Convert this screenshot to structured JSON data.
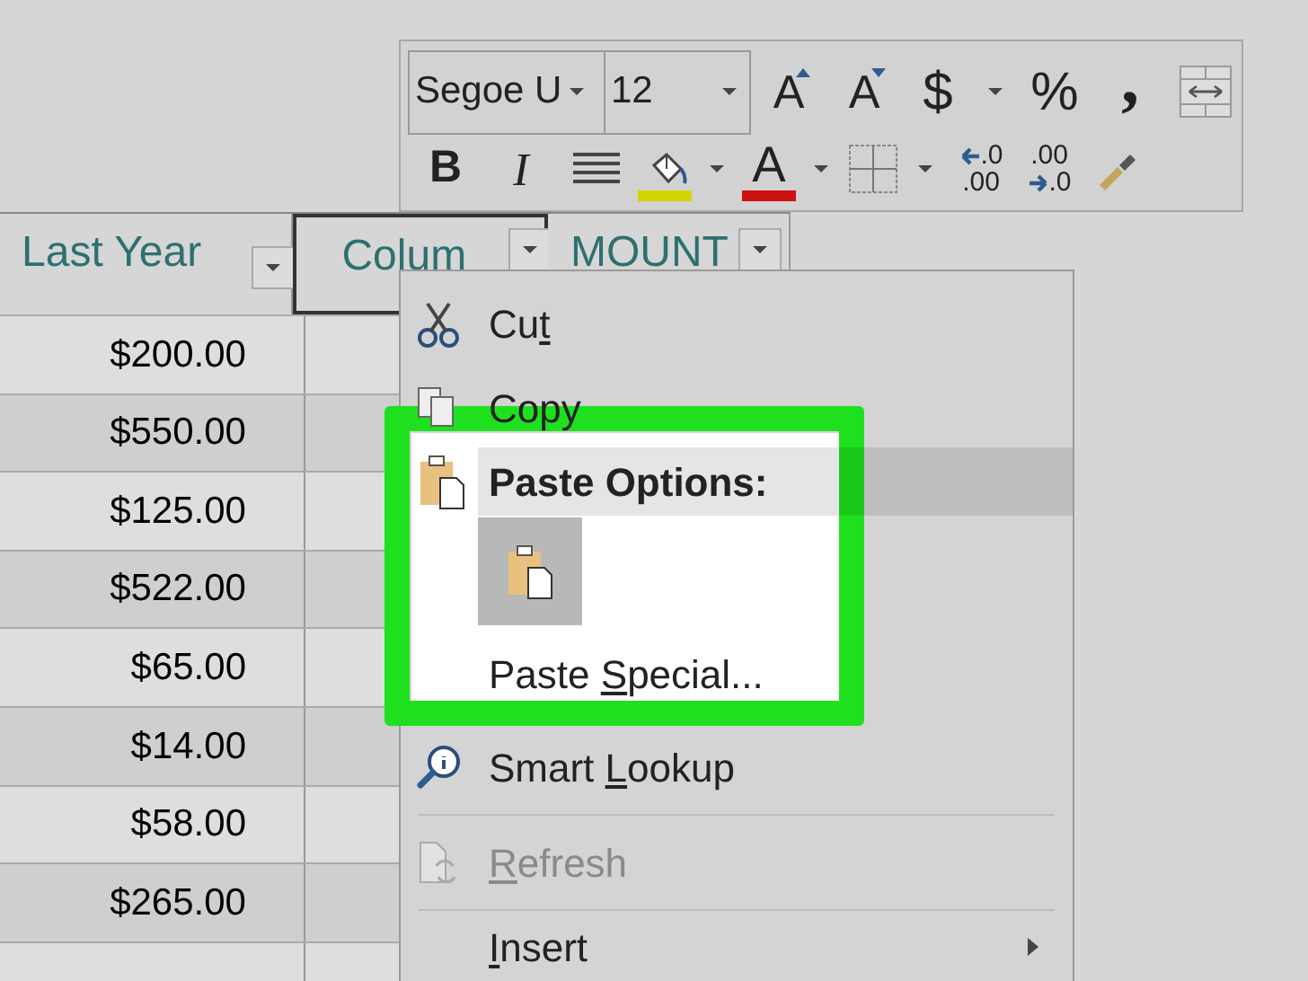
{
  "mini_toolbar": {
    "font": "Segoe U",
    "size": "12",
    "row_1": [
      {
        "kind": "grow_font",
        "glyph": "A"
      },
      {
        "kind": "shrink_font",
        "glyph": "A"
      },
      {
        "kind": "currency",
        "glyph": "$"
      },
      {
        "kind": "caret"
      },
      {
        "kind": "percent",
        "glyph": "%"
      },
      {
        "kind": "comma",
        "glyph": ","
      },
      {
        "kind": "merge"
      }
    ],
    "row_2": [
      {
        "kind": "bold",
        "glyph": "B"
      },
      {
        "kind": "italic",
        "glyph": "I"
      },
      {
        "kind": "align"
      },
      {
        "kind": "fill",
        "color": "#d4d400"
      },
      {
        "kind": "caret"
      },
      {
        "kind": "font_color",
        "glyph": "A",
        "color": "#cc1111"
      },
      {
        "kind": "caret"
      },
      {
        "kind": "borders"
      },
      {
        "kind": "caret"
      },
      {
        "kind": "increase_decimal",
        "top": ".0",
        "bottom": ".00"
      },
      {
        "kind": "decrease_decimal",
        "top": ".00",
        "bottom": ".0"
      },
      {
        "kind": "painter"
      }
    ]
  },
  "sheet": {
    "columns": [
      {
        "header": "Last Year",
        "filter": true,
        "selected": false
      },
      {
        "header": "Colum",
        "filter": true,
        "selected": true
      },
      {
        "header": "MOUNT",
        "filter": true,
        "selected": false
      }
    ],
    "rows": [
      "$200.00",
      "$550.00",
      "$125.00",
      "$522.00",
      "$65.00",
      "$14.00",
      "$58.00",
      "$265.00"
    ]
  },
  "context_menu": {
    "items": [
      {
        "kind": "cut",
        "before": "Cu",
        "key": "t",
        "disabled": false,
        "submenu": false
      },
      {
        "kind": "copy",
        "before": "Copy",
        "disabled": false,
        "submenu": false
      },
      {
        "kind": "paste_header",
        "before": "Paste Options:"
      },
      {
        "kind": "paste_button"
      },
      {
        "kind": "paste_special",
        "before": "Paste ",
        "key": "S",
        "after": "pecial...",
        "disabled": false,
        "submenu": false
      },
      {
        "kind": "lookup",
        "before": "Smart ",
        "key": "L",
        "after": "ookup",
        "disabled": false,
        "submenu": false
      },
      {
        "kind": "refresh",
        "key": "R",
        "after": "efresh",
        "disabled": true,
        "submenu": false
      },
      {
        "kind": "insert",
        "key": "I",
        "after": "nsert",
        "disabled": false,
        "submenu": true
      }
    ]
  },
  "highlight": {
    "kind": "frame",
    "color": "#1fe01f"
  }
}
